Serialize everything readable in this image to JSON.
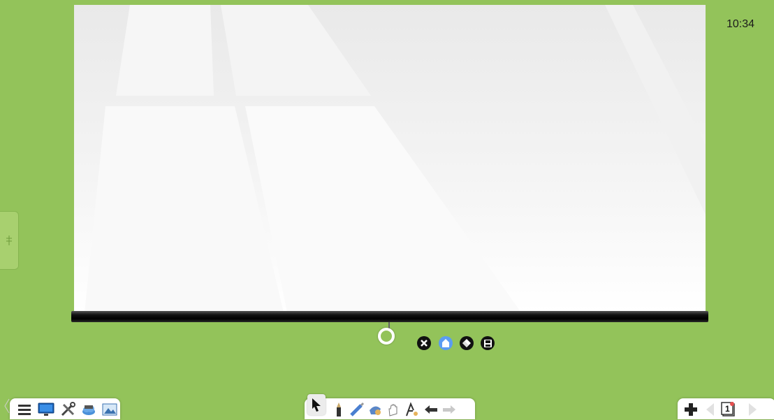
{
  "clock": {
    "time": "10:34"
  },
  "colors": {
    "background": "#93c35a",
    "screen": "#f4f4f4",
    "screen_bar": "#111111",
    "accent_blue": "#5b9cf2"
  },
  "screen_controls": [
    "close-icon",
    "pen-up-icon",
    "eraser-icon",
    "save-icon"
  ],
  "left_toolbar": [
    "menu-icon",
    "desktop-icon",
    "tools-icon",
    "cloud-icon",
    "image-icon"
  ],
  "center_toolbar": [
    "select-arrow-icon",
    "pen-icon",
    "brush-icon",
    "eraser-icon",
    "hand-icon",
    "handwriting-icon",
    "undo-icon",
    "redo-icon"
  ],
  "right_toolbar": {
    "icons": [
      "add-icon",
      "prev-page-icon",
      "page-icon",
      "next-page-icon"
    ],
    "page_number": "1"
  }
}
